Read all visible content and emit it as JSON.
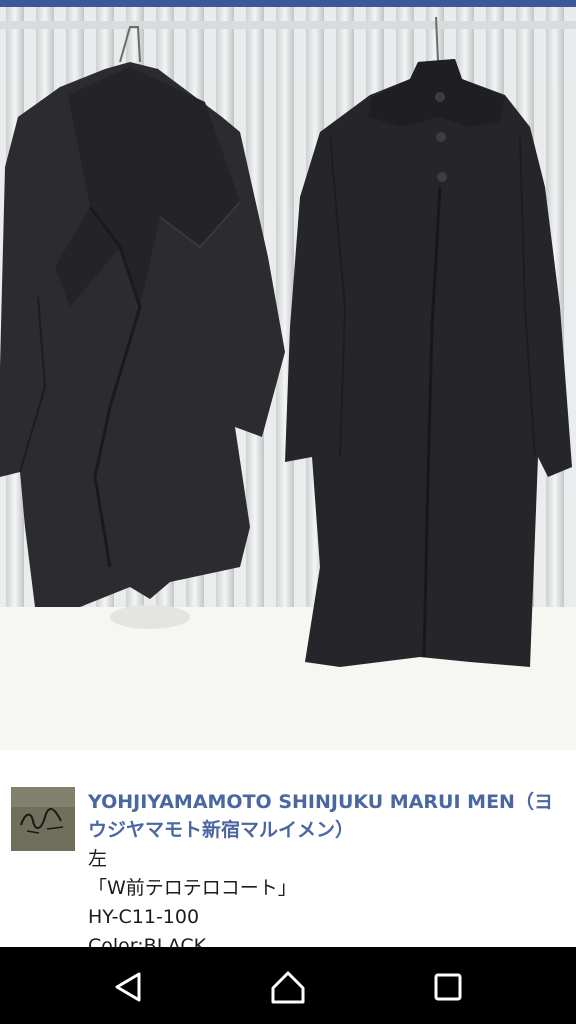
{
  "post": {
    "page_name": "YOHJIYAMAMOTO SHINJUKU MARUI MEN（ヨウジヤマモト新宿マルイメン）",
    "body_lines": [
      "左",
      "「W前テロテロコート」",
      "HY-C11-100",
      "Color:BLACK"
    ],
    "avatar_icon": "brand-logo-avatar"
  },
  "navbar": {
    "back_icon": "back-triangle-icon",
    "home_icon": "home-icon",
    "recents_icon": "recents-square-icon"
  },
  "colors": {
    "top_bar": "#3b5998",
    "page_name": "#4b67a1",
    "nav_background": "#000000"
  }
}
